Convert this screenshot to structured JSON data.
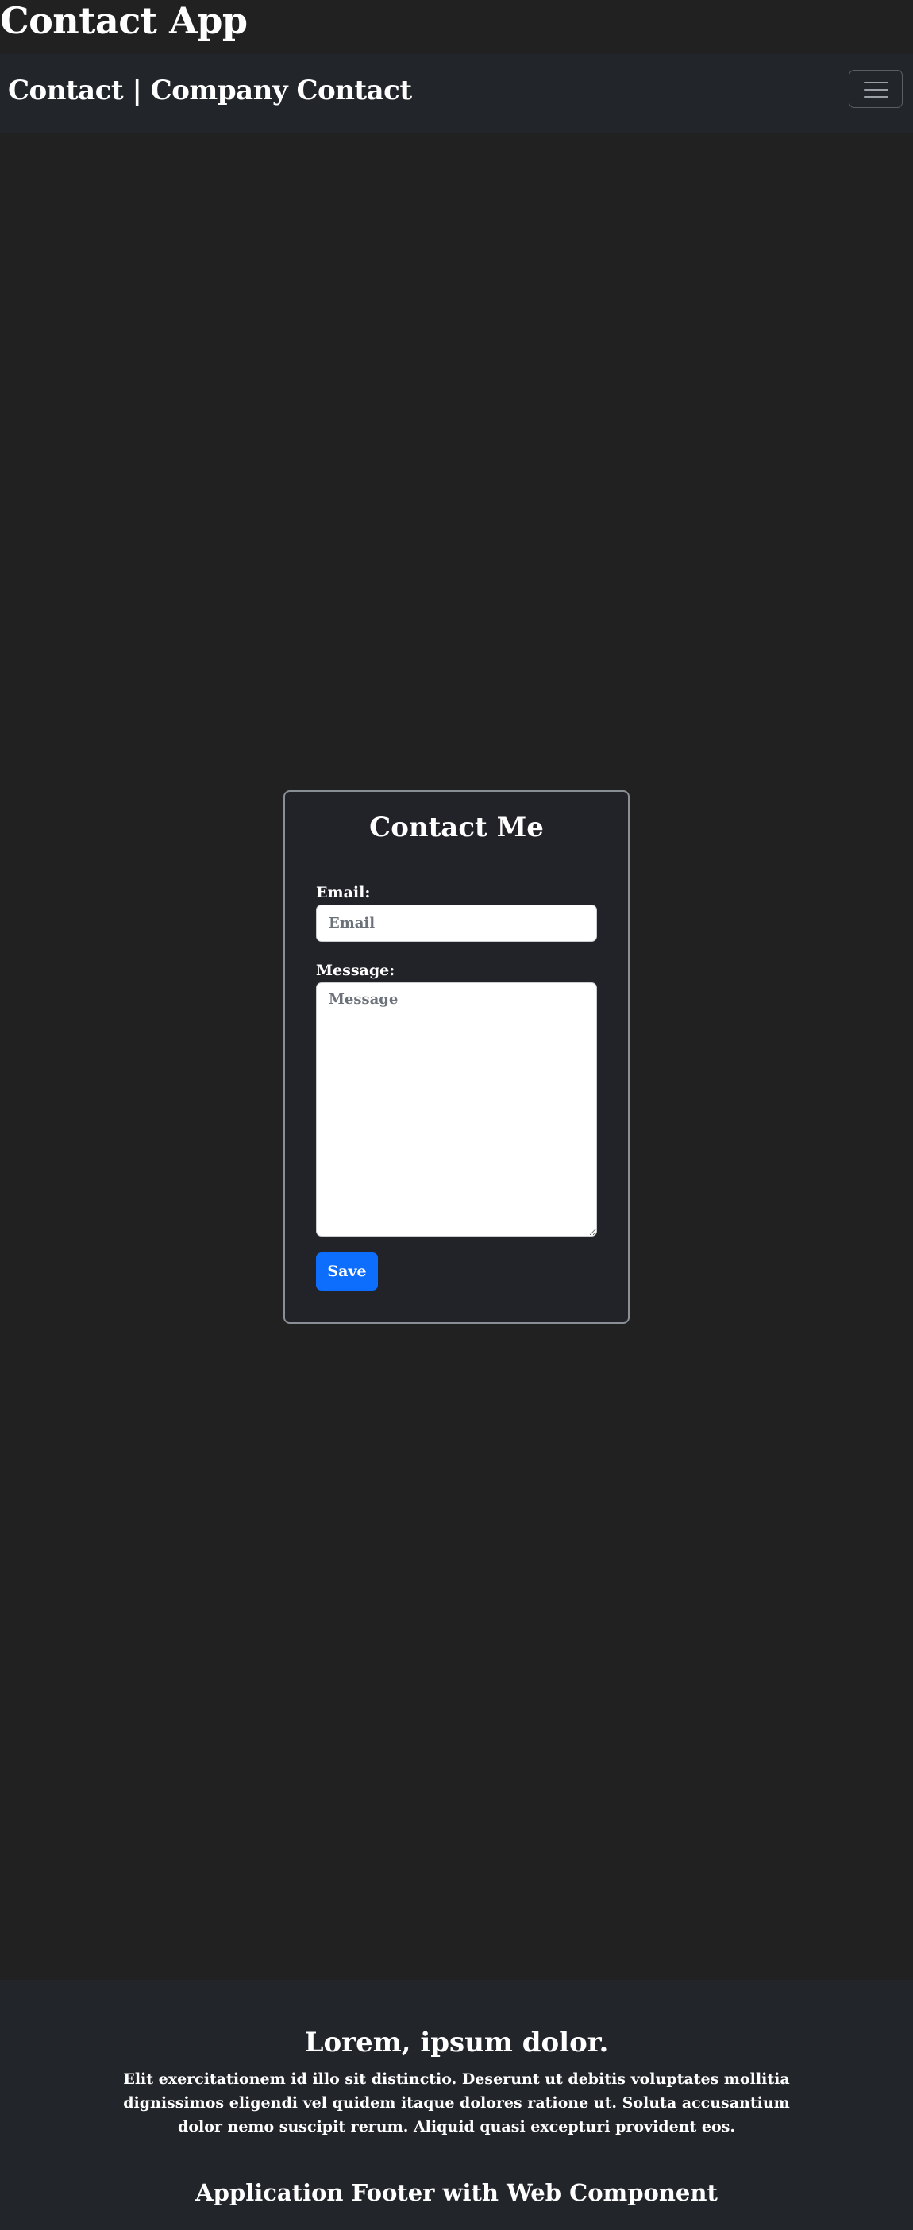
{
  "app": {
    "title": "Contact App"
  },
  "navbar": {
    "brand": "Contact | Company Contact",
    "toggler_icon": "hamburger-menu-icon"
  },
  "contact_form": {
    "title": "Contact Me",
    "email_label": "Email:",
    "email_placeholder": "Email",
    "email_value": "",
    "message_label": "Message:",
    "message_placeholder": "Message",
    "message_value": "",
    "save_label": "Save"
  },
  "footer": {
    "heading": "Lorem, ipsum dolor.",
    "text": "Elit exercitationem id illo sit distinctio. Deserunt ut debitis voluptates mollitia dignissimos eligendi vel quidem itaque dolores ratione ut. Soluta accusantium dolor nemo suscipit rerum. Aliquid quasi excepturi provident eos.",
    "component_title": "Application Footer with Web Component"
  },
  "colors": {
    "page_background": "#212121",
    "navbar_background": "#22252a",
    "card_background": "#212329",
    "card_border": "#8a8f96",
    "primary_button": "#0d6efd",
    "text": "#ffffff"
  }
}
